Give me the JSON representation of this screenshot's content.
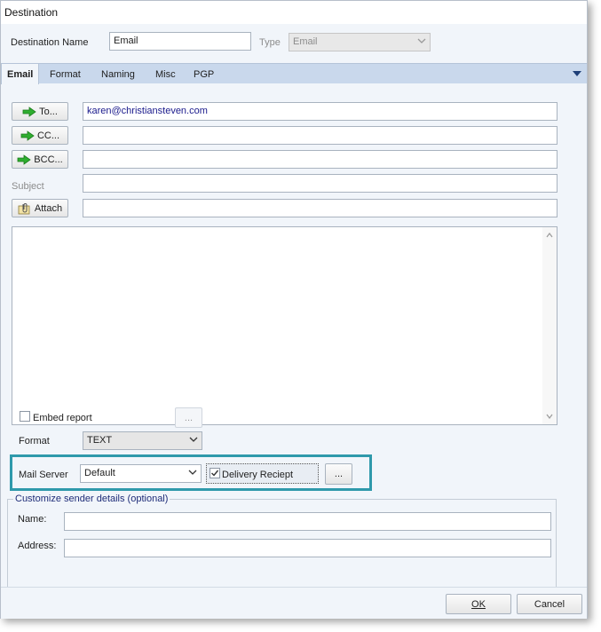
{
  "window": {
    "title": "Destination"
  },
  "header": {
    "destination_name_label": "Destination Name",
    "destination_name_value": "Email",
    "type_label": "Type",
    "type_value": "Email"
  },
  "tabs": [
    {
      "label": "Email",
      "active": true
    },
    {
      "label": "Format",
      "active": false
    },
    {
      "label": "Naming",
      "active": false
    },
    {
      "label": "Misc",
      "active": false
    },
    {
      "label": "PGP",
      "active": false
    }
  ],
  "email": {
    "to_label": "To...",
    "to_value": "karen@christiansteven.com",
    "cc_label": "CC...",
    "cc_value": "",
    "bcc_label": "BCC...",
    "bcc_value": "",
    "subject_label": "Subject",
    "subject_value": "",
    "attach_label": "Attach",
    "attach_value": "",
    "body_value": ""
  },
  "embed": {
    "label": "Embed report",
    "checked": false,
    "button_label": "..."
  },
  "format": {
    "label": "Format",
    "value": "TEXT"
  },
  "mail_server": {
    "label": "Mail Server",
    "value": "Default",
    "delivery_receipt_label": "Delivery Reciept",
    "delivery_receipt_checked": true,
    "more_button_label": "..."
  },
  "sender": {
    "group_title": "Customize sender details (optional)",
    "name_label": "Name:",
    "name_value": "",
    "address_label": "Address:",
    "address_value": ""
  },
  "footer": {
    "ok_label": "OK",
    "cancel_label": "Cancel"
  },
  "colors": {
    "tab_bar": "#c9d8ec",
    "client_bg": "#f1f5fa",
    "highlight_border": "#2f99ab",
    "arrow_green": "#2fae2f",
    "link_text": "#1a1a8c"
  },
  "icons": {
    "to_button": "green-arrow-icon",
    "cc_button": "green-arrow-icon",
    "bcc_button": "green-arrow-icon",
    "attach_button": "paperclip-icon",
    "tab_overflow": "dropdown-triangle-icon"
  }
}
